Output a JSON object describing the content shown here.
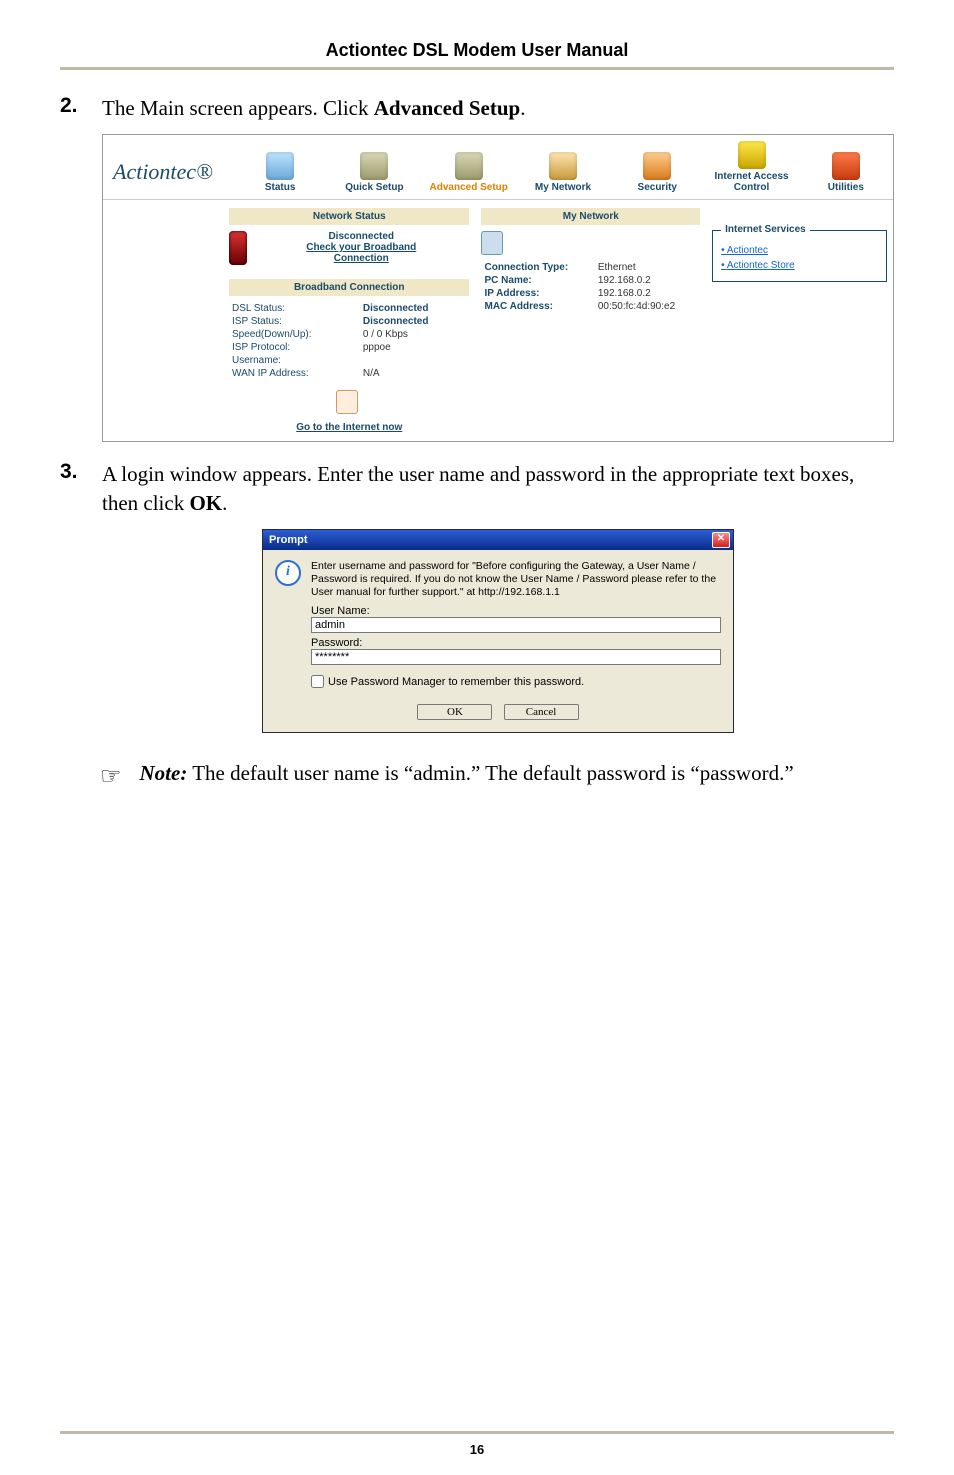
{
  "manual_title": "Actiontec DSL Modem User Manual",
  "page_number": "16",
  "steps": {
    "s2": {
      "num": "2.",
      "text_a": "The Main screen appears. Click ",
      "bold": "Advanced Setup",
      "text_b": "."
    },
    "s3": {
      "num": "3.",
      "text_a": " A login window appears. Enter the user name and password in the appropriate text boxes, then click ",
      "bold": "OK",
      "text_b": "."
    }
  },
  "modem": {
    "logo": "Actiontec®",
    "tabs": {
      "status": "Status",
      "quick": "Quick Setup",
      "advanced": "Advanced Setup",
      "mynet": "My Network",
      "security": "Security",
      "iac": "Internet Access Control",
      "util": "Utilities"
    },
    "left": {
      "heading": "Network Status",
      "disconnected": "Disconnected",
      "check1": "Check your Broadband",
      "check2": "Connection",
      "bb_heading": "Broadband Connection",
      "rows": {
        "dsl_l": "DSL Status:",
        "dsl_v": "Disconnected",
        "isp_l": "ISP Status:",
        "isp_v": "Disconnected",
        "spd_l": "Speed(Down/Up):",
        "spd_v": "0 / 0 Kbps",
        "proto_l": "ISP Protocol:",
        "proto_v": "pppoe",
        "usr_l": "Username:",
        "usr_v": "",
        "wan_l": "WAN IP Address:",
        "wan_v": "N/A"
      },
      "go": "Go to the Internet now"
    },
    "mid": {
      "heading": "My Network",
      "rows": {
        "ct_l": "Connection Type:",
        "ct_v": "Ethernet",
        "pc_l": "PC Name:",
        "pc_v": "192.168.0.2",
        "ip_l": "IP Address:",
        "ip_v": "192.168.0.2",
        "mac_l": "MAC Address:",
        "mac_v": "00:50:fc:4d:90:e2"
      }
    },
    "services": {
      "legend": "Internet Services",
      "a1": "Actiontec",
      "a2": "Actiontec Store"
    }
  },
  "prompt": {
    "title": "Prompt",
    "message": "Enter username and password for \"Before configuring the Gateway, a User Name / Password is required. If you do not know the User Name / Password please refer to the User manual for further support.\" at http://192.168.1.1",
    "user_label": "User Name:",
    "user_value": "admin",
    "pass_label": "Password:",
    "pass_value": "********",
    "chk_label": "Use Password Manager to remember this password.",
    "ok": "OK",
    "cancel": "Cancel"
  },
  "note": {
    "label": "Note:",
    "text": " The default user name is “admin.” The default password is “password.”"
  }
}
